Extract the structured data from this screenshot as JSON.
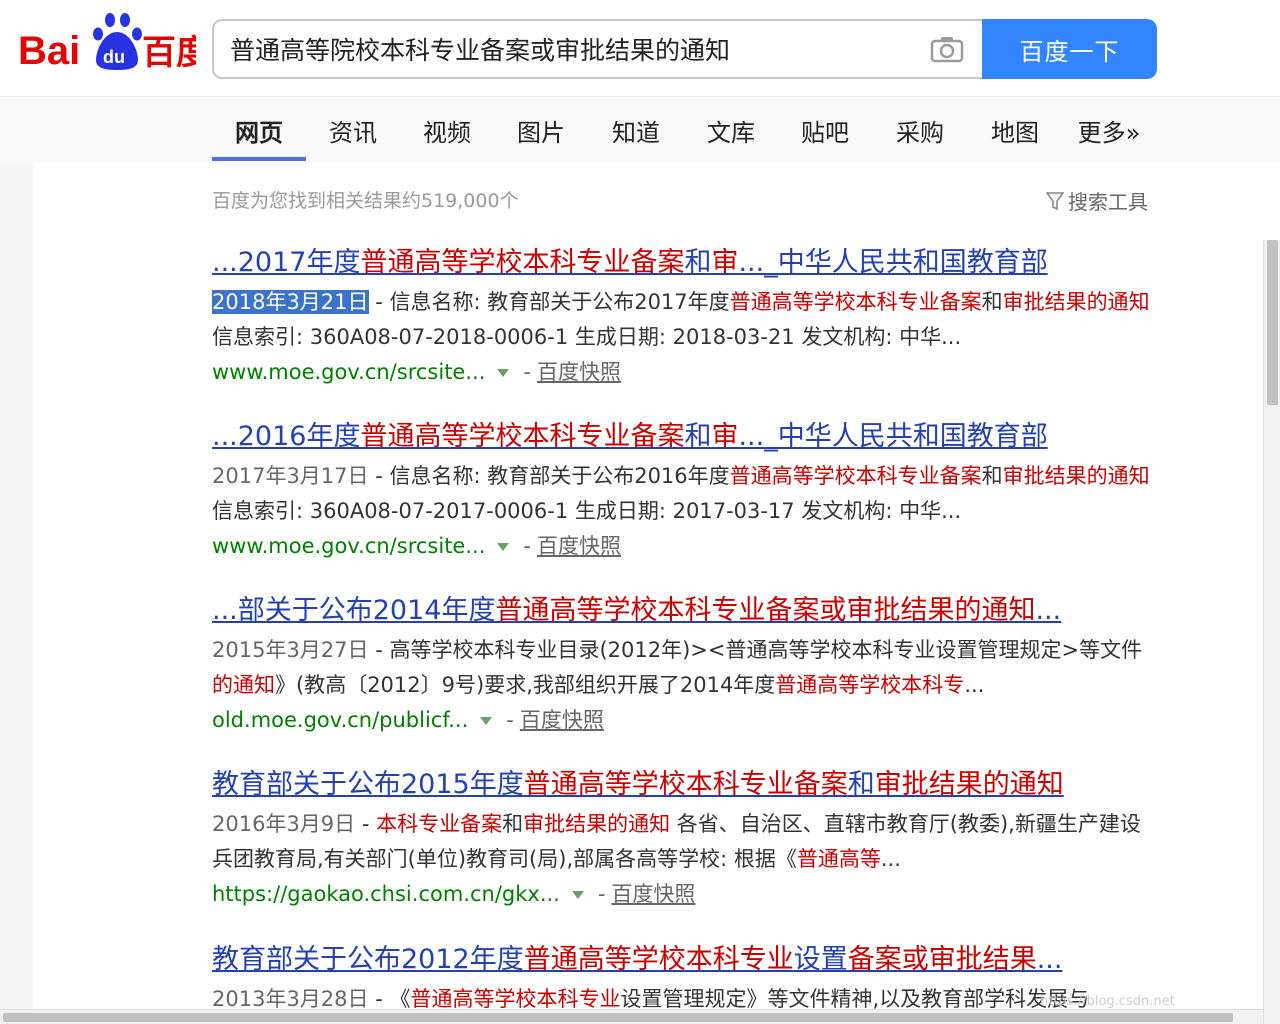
{
  "header": {
    "logo_text": "Baidu百度",
    "search_value": "普通高等院校本科专业备案或审批结果的通知",
    "search_button": "百度一下"
  },
  "tabs": [
    {
      "label": "网页",
      "active": true
    },
    {
      "label": "资讯"
    },
    {
      "label": "视频"
    },
    {
      "label": "图片"
    },
    {
      "label": "知道"
    },
    {
      "label": "文库"
    },
    {
      "label": "贴吧"
    },
    {
      "label": "采购"
    },
    {
      "label": "地图"
    },
    {
      "label": "更多»"
    }
  ],
  "result_count": "百度为您找到相关结果约519,000个",
  "search_tools": "搜索工具",
  "results": [
    {
      "title": [
        {
          "t": "...2017年度"
        },
        {
          "t": "普通高等学校本科专业备案",
          "hl": true
        },
        {
          "t": "和"
        },
        {
          "t": "审",
          "hl": true
        },
        {
          "t": "..._中华人民共和国教育部"
        }
      ],
      "date": "2018年3月21日",
      "abstract": [
        {
          "t": " - 信息名称: 教育部关于公布2017年度"
        },
        {
          "t": "普通高等学校本科专业备案",
          "hl": true
        },
        {
          "t": "和"
        },
        {
          "t": "审批结果的通知",
          "hl": true
        },
        {
          "t": " 信息索引: 360A08-07-2018-0006-1 生成日期: 2018-03-21 发文机构: 中华..."
        }
      ],
      "url": "www.moe.gov.cn/srcsite...",
      "snapshot": "百度快照"
    },
    {
      "title": [
        {
          "t": "...2016年度"
        },
        {
          "t": "普通高等学校本科专业备案",
          "hl": true
        },
        {
          "t": "和"
        },
        {
          "t": "审",
          "hl": true
        },
        {
          "t": "..._中华人民共和国教育部"
        }
      ],
      "date": "2017年3月17日",
      "abstract": [
        {
          "t": " - 信息名称: 教育部关于公布2016年度"
        },
        {
          "t": "普通高等学校本科专业备案",
          "hl": true
        },
        {
          "t": "和"
        },
        {
          "t": "审批结果的通知",
          "hl": true
        },
        {
          "t": " 信息索引: 360A08-07-2017-0006-1 生成日期: 2017-03-17 发文机构: 中华..."
        }
      ],
      "url": "www.moe.gov.cn/srcsite...",
      "snapshot": "百度快照"
    },
    {
      "title": [
        {
          "t": "...部关于公布2014年度"
        },
        {
          "t": "普通高等学校本科专业备案或审批结果的通知",
          "hl": true
        },
        {
          "t": "..."
        }
      ],
      "date": "2015年3月27日",
      "abstract": [
        {
          "t": " - 高等学校本科专业目录(2012年)><普通高等学校本科专业设置管理规定>等文件"
        },
        {
          "t": "的通知",
          "hl": true
        },
        {
          "t": "》(教高〔2012〕9号)要求,我部组织开展了2014年度"
        },
        {
          "t": "普通高等学校本科专",
          "hl": true
        },
        {
          "t": "..."
        }
      ],
      "url": "old.moe.gov.cn/publicf...",
      "snapshot": "百度快照"
    },
    {
      "title": [
        {
          "t": "教育部关于公布2015年度"
        },
        {
          "t": "普通高等学校本科专业备案",
          "hl": true
        },
        {
          "t": "和"
        },
        {
          "t": "审批结果的通知",
          "hl": true
        }
      ],
      "date": "2016年3月9日",
      "abstract": [
        {
          "t": " - "
        },
        {
          "t": "本科专业备案",
          "hl": true
        },
        {
          "t": "和"
        },
        {
          "t": "审批结果的通知",
          "hl": true
        },
        {
          "t": " 各省、自治区、直辖市教育厅(教委),新疆生产建设兵团教育局,有关部门(单位)教育司(局),部属各高等学校: 根据《"
        },
        {
          "t": "普通高等",
          "hl": true
        },
        {
          "t": "..."
        }
      ],
      "url": "https://gaokao.chsi.com.cn/gkx...",
      "snapshot": "百度快照"
    },
    {
      "title": [
        {
          "t": "教育部关于公布2012年度"
        },
        {
          "t": "普通高等学校本科专业",
          "hl": true
        },
        {
          "t": "设置"
        },
        {
          "t": "备案或审批结果",
          "hl": true
        },
        {
          "t": "..."
        }
      ],
      "date": "2013年3月28日",
      "abstract": [
        {
          "t": " - 《"
        },
        {
          "t": "普通高等学校本科专业",
          "hl": true
        },
        {
          "t": "设置管理规定》等文件精神,以及教育部学科发展与"
        }
      ]
    }
  ],
  "watermark": "https://blog.csdn.net"
}
